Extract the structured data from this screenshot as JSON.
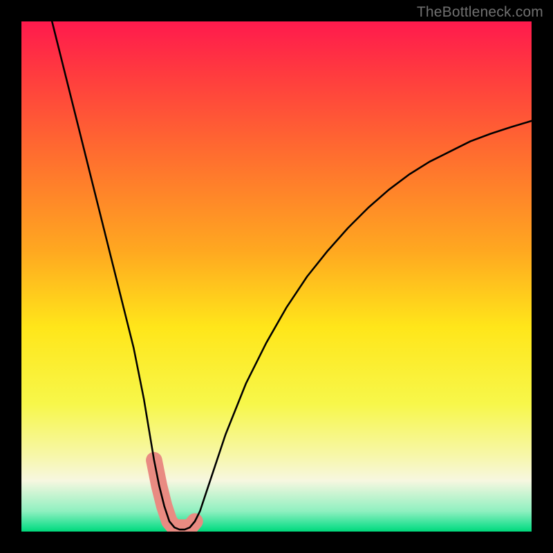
{
  "watermark": "TheBottleneck.com",
  "chart_data": {
    "type": "line",
    "title": "",
    "xlabel": "",
    "ylabel": "",
    "xlim": [
      0,
      100
    ],
    "ylim": [
      0,
      100
    ],
    "grid": false,
    "legend": false,
    "series": [
      {
        "name": "curve",
        "x": [
          6,
          8,
          10,
          12,
          14,
          16,
          18,
          20,
          22,
          24,
          25,
          26,
          27,
          28,
          29,
          30,
          31,
          32,
          33,
          34,
          35,
          36,
          38,
          40,
          44,
          48,
          52,
          56,
          60,
          64,
          68,
          72,
          76,
          80,
          84,
          88,
          92,
          96,
          100
        ],
        "y": [
          100,
          92,
          84,
          76,
          68,
          60,
          52,
          44,
          36,
          26,
          20,
          14,
          9,
          5,
          2,
          0.8,
          0.4,
          0.4,
          0.8,
          2,
          4,
          7,
          13,
          19,
          29,
          37,
          44,
          50,
          55,
          59.5,
          63.5,
          67,
          70,
          72.5,
          74.5,
          76.5,
          78,
          79.3,
          80.5
        ]
      }
    ],
    "highlight_band": {
      "name": "optimal-range",
      "color": "#e98b82",
      "x_range": [
        25.5,
        34.5
      ],
      "y": 0.8
    },
    "background": {
      "type": "vertical-gradient",
      "stops": [
        {
          "pos": 0.0,
          "color": "#ff1a4d"
        },
        {
          "pos": 0.45,
          "color": "#ffa820"
        },
        {
          "pos": 0.75,
          "color": "#f7f74a"
        },
        {
          "pos": 0.96,
          "color": "#8ff0c0"
        },
        {
          "pos": 1.0,
          "color": "#00d87a"
        }
      ]
    }
  }
}
